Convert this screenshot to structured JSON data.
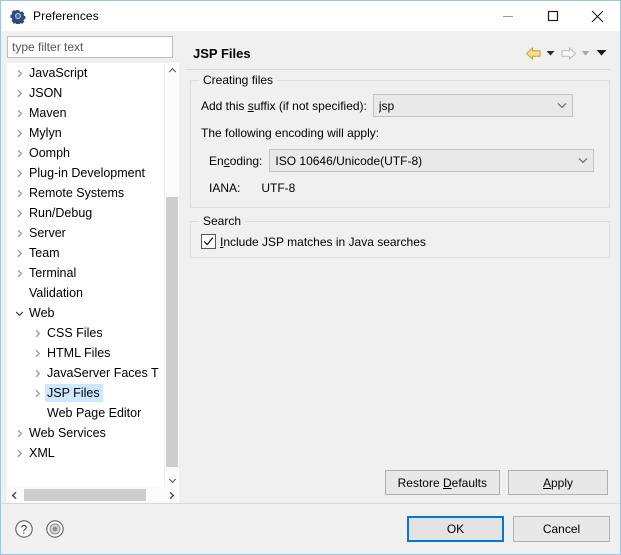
{
  "window": {
    "title": "Preferences",
    "icon": "preferences-gear-icon",
    "controls": {
      "minimize": "minimize-icon",
      "maximize": "maximize-icon",
      "close": "close-icon"
    }
  },
  "filter": {
    "value": "",
    "placeholder": "type filter text"
  },
  "tree": {
    "items": [
      {
        "label": "JavaScript",
        "depth": 1,
        "expandable": true,
        "expanded": false,
        "selected": false
      },
      {
        "label": "JSON",
        "depth": 1,
        "expandable": true,
        "expanded": false,
        "selected": false
      },
      {
        "label": "Maven",
        "depth": 1,
        "expandable": true,
        "expanded": false,
        "selected": false
      },
      {
        "label": "Mylyn",
        "depth": 1,
        "expandable": true,
        "expanded": false,
        "selected": false
      },
      {
        "label": "Oomph",
        "depth": 1,
        "expandable": true,
        "expanded": false,
        "selected": false
      },
      {
        "label": "Plug-in Development",
        "depth": 1,
        "expandable": true,
        "expanded": false,
        "selected": false
      },
      {
        "label": "Remote Systems",
        "depth": 1,
        "expandable": true,
        "expanded": false,
        "selected": false
      },
      {
        "label": "Run/Debug",
        "depth": 1,
        "expandable": true,
        "expanded": false,
        "selected": false
      },
      {
        "label": "Server",
        "depth": 1,
        "expandable": true,
        "expanded": false,
        "selected": false
      },
      {
        "label": "Team",
        "depth": 1,
        "expandable": true,
        "expanded": false,
        "selected": false
      },
      {
        "label": "Terminal",
        "depth": 1,
        "expandable": true,
        "expanded": false,
        "selected": false
      },
      {
        "label": "Validation",
        "depth": 1,
        "expandable": false,
        "expanded": false,
        "selected": false
      },
      {
        "label": "Web",
        "depth": 1,
        "expandable": true,
        "expanded": true,
        "selected": false
      },
      {
        "label": "CSS Files",
        "depth": 2,
        "expandable": true,
        "expanded": false,
        "selected": false
      },
      {
        "label": "HTML Files",
        "depth": 2,
        "expandable": true,
        "expanded": false,
        "selected": false
      },
      {
        "label": "JavaServer Faces T",
        "depth": 2,
        "expandable": true,
        "expanded": false,
        "selected": false
      },
      {
        "label": "JSP Files",
        "depth": 2,
        "expandable": true,
        "expanded": false,
        "selected": true
      },
      {
        "label": "Web Page Editor",
        "depth": 2,
        "expandable": false,
        "expanded": false,
        "selected": false
      },
      {
        "label": "Web Services",
        "depth": 1,
        "expandable": true,
        "expanded": false,
        "selected": false
      },
      {
        "label": "XML",
        "depth": 1,
        "expandable": true,
        "expanded": false,
        "selected": false
      }
    ],
    "scroll": {
      "vertical_thumb": "tree-vertical-scroll-thumb",
      "horizontal_thumb": "tree-horizontal-scroll-thumb"
    }
  },
  "page": {
    "title": "JSP Files",
    "nav": {
      "back": "back-arrow-icon",
      "back_menu": "back-history-dropdown-icon",
      "forward": "forward-arrow-icon",
      "forward_menu": "forward-history-dropdown-icon",
      "view_menu": "view-menu-chevron-icon"
    },
    "creating_files": {
      "legend": "Creating files",
      "suffix_label_pre": "Add this ",
      "suffix_label_accel": "s",
      "suffix_label_post": "uffix (if not specified):",
      "suffix_value": "jsp",
      "encoding_note": "The following encoding will apply:",
      "encoding_label_pre": "En",
      "encoding_label_accel": "c",
      "encoding_label_post": "oding:",
      "encoding_value": "ISO 10646/Unicode(UTF-8)",
      "iana_label": "IANA:",
      "iana_value": "UTF-8"
    },
    "search": {
      "legend": "Search",
      "checkbox_accel": "I",
      "checkbox_label_post": "nclude JSP matches in Java searches",
      "checked": true
    },
    "actions": {
      "restore_pre": "Restore ",
      "restore_accel": "D",
      "restore_post": "efaults",
      "apply_accel": "A",
      "apply_post": "pply"
    }
  },
  "footer": {
    "help_icon": "help-question-icon",
    "extra_icon": "circle-target-icon",
    "ok_label": "OK",
    "cancel_label": "Cancel"
  },
  "colors": {
    "accent_focus": "#0078d7",
    "selection": "#cde8ff",
    "back_arrow": "#e8c266",
    "panel_bg": "#f0f0f0"
  }
}
